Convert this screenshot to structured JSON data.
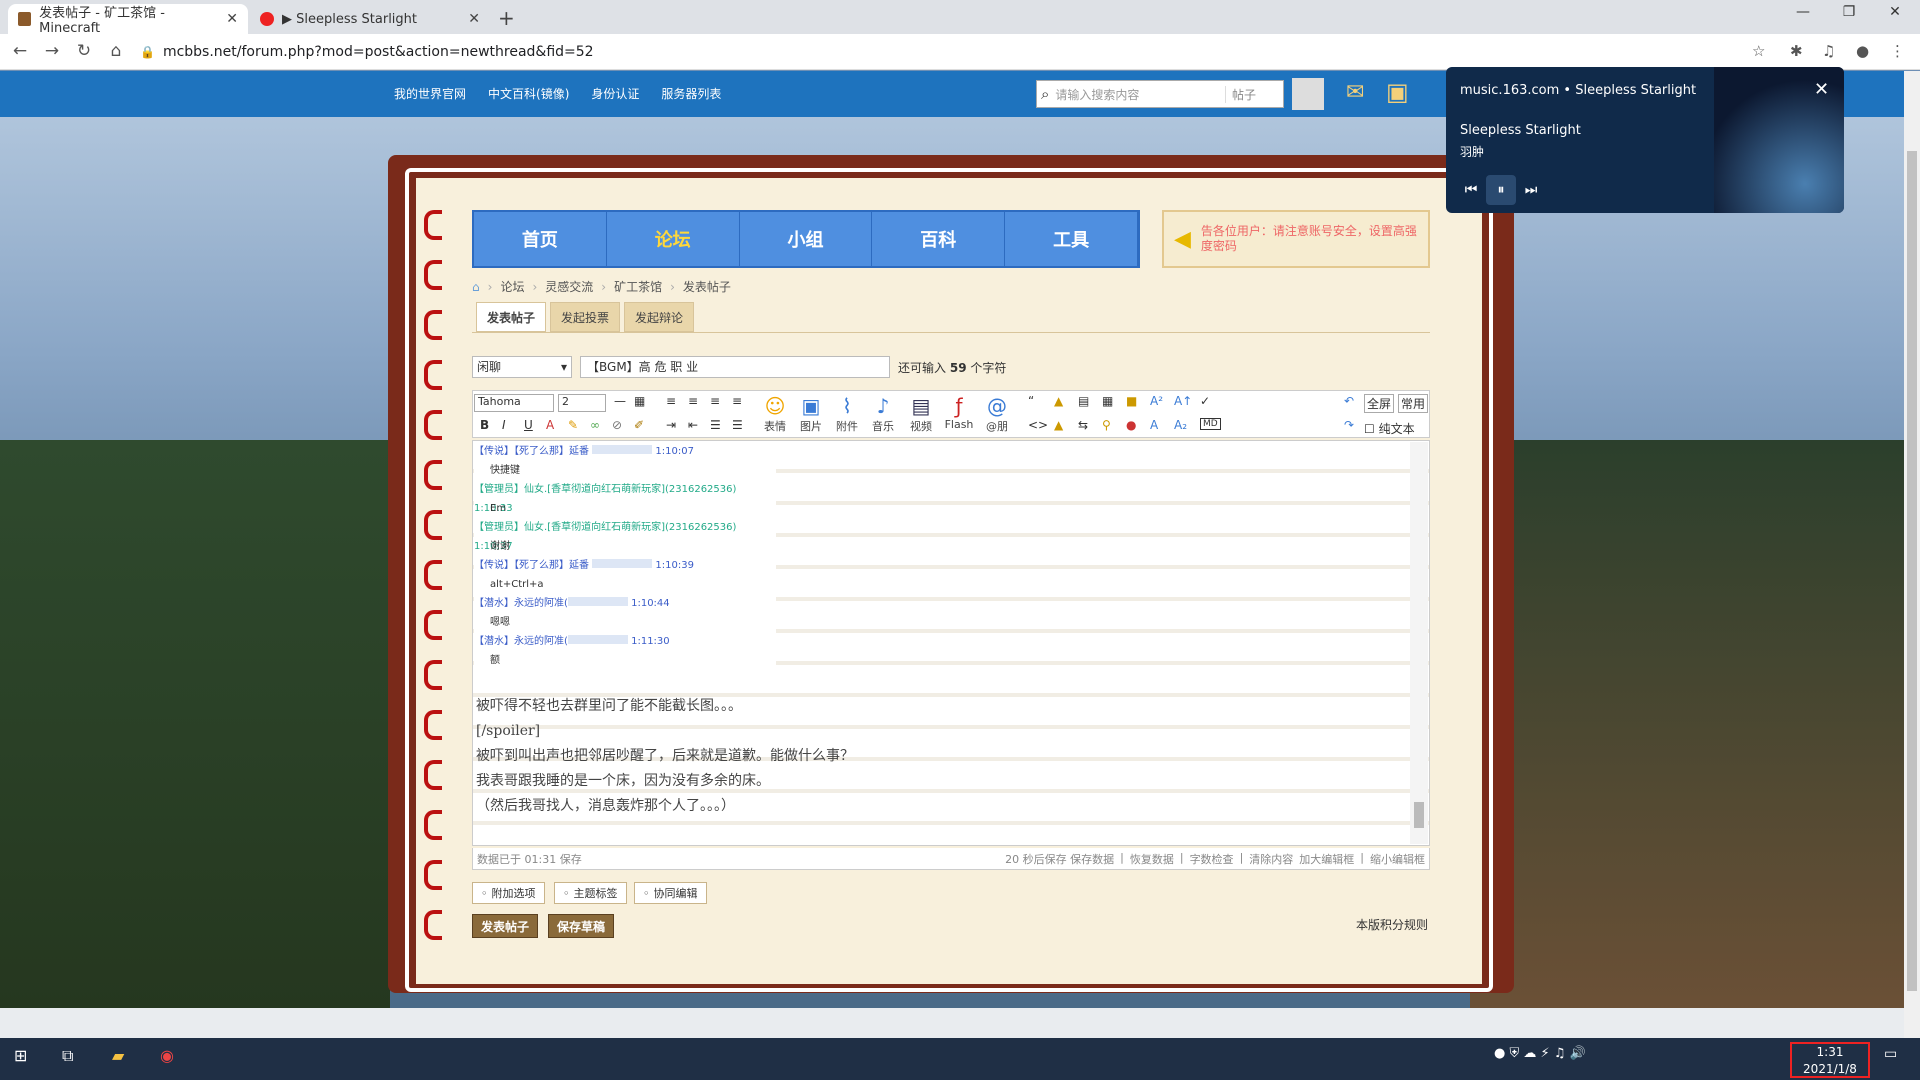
{
  "browser": {
    "tabs": [
      {
        "title": "发表帖子 - 矿工茶馆 - Minecraft"
      },
      {
        "title": "▶ Sleepless Starlight"
      }
    ],
    "url": "mcbbs.net/forum.php?mod=post&action=newthread&fid=52"
  },
  "topnav": {
    "links": [
      "我的世界官网",
      "中文百科(镜像)",
      "身份认证",
      "服务器列表"
    ],
    "search_placeholder": "请输入搜索内容",
    "search_type": "帖子"
  },
  "forum_nav": [
    "首页",
    "论坛",
    "小组",
    "百科",
    "工具"
  ],
  "notice": "告各位用户：请注意账号安全，设置高强度密码",
  "breadcrumb": [
    "论坛",
    "灵感交流",
    "矿工茶馆",
    "发表帖子"
  ],
  "post_tabs": [
    "发表帖子",
    "发起投票",
    "发起辩论"
  ],
  "category": "闲聊",
  "subject": "【BGM】高 危 职 业",
  "remain": {
    "prefix": "还可输入",
    "count": "59",
    "suffix": "个字符"
  },
  "editor": {
    "font": "Tahoma",
    "size": "2",
    "tools": [
      "表情",
      "图片",
      "附件",
      "音乐",
      "视频",
      "Flash",
      "@朋"
    ],
    "right": {
      "fullscreen": "全屏",
      "common": "常用",
      "plain": "纯文本"
    },
    "chat": [
      {
        "who": "【传说】【死了么那】延番",
        "time": "1:10:07",
        "msg": "快捷键",
        "cls": "h"
      },
      {
        "who": "【管理员】仙女.[香草彻道向红石萌新玩家](2316262536)",
        "time": "1:10:33",
        "msg": "Em",
        "cls": ""
      },
      {
        "who": "【管理员】仙女.[香草彻道向红石萌新玩家](2316262536)",
        "time": "1:10:37",
        "msg": "谢谢",
        "cls": ""
      },
      {
        "who": "【传说】【死了么那】延番",
        "time": "1:10:39",
        "msg": "alt+Ctrl+a",
        "cls": "h"
      },
      {
        "who": "【潜水】永远的阿准(",
        "time": "1:10:44",
        "msg": "嗯嗯",
        "cls": "h"
      },
      {
        "who": "【潜水】永远的阿准(",
        "time": "1:11:30",
        "msg": "额",
        "cls": "h"
      }
    ],
    "lines": [
      "被吓得不轻也去群里问了能不能截长图。。。",
      "[/spoiler]",
      "被吓到叫出声也把邻居吵醒了，后来就是道歉。能做什么事？",
      "我表哥跟我睡的是一个床，因为没有多余的床。",
      "（然后我哥找人，消息轰炸那个人了。。。）"
    ],
    "footer_left": "数据已于 01:31 保存",
    "footer_right": [
      "20 秒后保存 保存数据",
      "恢复数据",
      "字数检查",
      "清除内容",
      "加大编辑框",
      "缩小编辑框"
    ]
  },
  "options": [
    "附加选项",
    "主题标签",
    "协同编辑"
  ],
  "submit": "发表帖子",
  "draft": "保存草稿",
  "rules": "本版积分规则",
  "music": {
    "site": "music.163.com",
    "title": "Sleepless Starlight",
    "song": "Sleepless Starlight",
    "artist": "羽肿"
  },
  "clock": {
    "time": "1:31",
    "date": "2021/1/8"
  }
}
